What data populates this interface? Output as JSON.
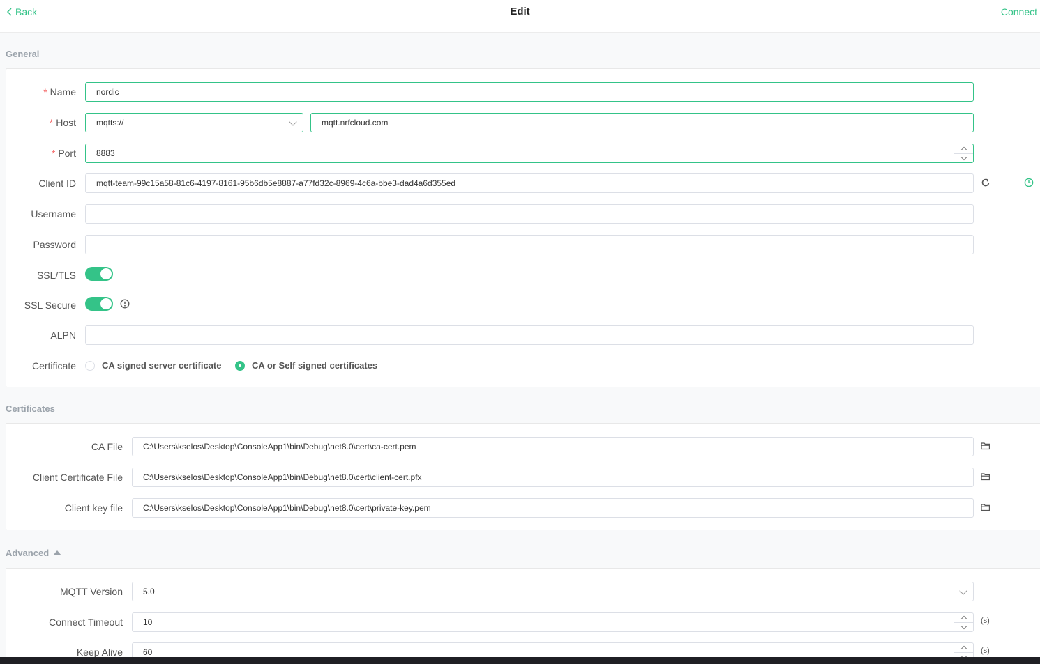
{
  "header": {
    "back_label": "Back",
    "title": "Edit",
    "connect_label": "Connect"
  },
  "general": {
    "section_title": "General",
    "name": {
      "label": "Name",
      "value": "nordic"
    },
    "host": {
      "label": "Host",
      "protocol": "mqtts://",
      "value": "mqtt.nrfcloud.com"
    },
    "port": {
      "label": "Port",
      "value": "8883"
    },
    "client_id": {
      "label": "Client ID",
      "value": "mqtt-team-99c15a58-81c6-4197-8161-95b6db5e8887-a77fd32c-8969-4c6a-bbe3-dad4a6d355ed"
    },
    "username": {
      "label": "Username",
      "value": ""
    },
    "password": {
      "label": "Password",
      "value": ""
    },
    "ssl_tls": {
      "label": "SSL/TLS",
      "enabled": true
    },
    "ssl_secure": {
      "label": "SSL Secure",
      "enabled": true
    },
    "alpn": {
      "label": "ALPN",
      "value": ""
    },
    "certificate": {
      "label": "Certificate",
      "options": [
        "CA signed server certificate",
        "CA or Self signed certificates"
      ],
      "selected": "CA or Self signed certificates"
    },
    "required_mark": "*"
  },
  "certificates": {
    "section_title": "Certificates",
    "ca_file": {
      "label": "CA File",
      "value": "C:\\Users\\kselos\\Desktop\\ConsoleApp1\\bin\\Debug\\net8.0\\cert\\ca-cert.pem"
    },
    "client_cert": {
      "label": "Client Certificate File",
      "value": "C:\\Users\\kselos\\Desktop\\ConsoleApp1\\bin\\Debug\\net8.0\\cert\\client-cert.pfx"
    },
    "client_key": {
      "label": "Client key file",
      "value": "C:\\Users\\kselos\\Desktop\\ConsoleApp1\\bin\\Debug\\net8.0\\cert\\private-key.pem"
    }
  },
  "advanced": {
    "section_title": "Advanced",
    "mqtt_version": {
      "label": "MQTT Version",
      "value": "5.0"
    },
    "connect_timeout": {
      "label": "Connect Timeout",
      "value": "10",
      "unit": "(s)"
    },
    "keep_alive": {
      "label": "Keep Alive",
      "value": "60",
      "unit": "(s)"
    }
  },
  "colors": {
    "accent": "#34c388",
    "required": "#f56c6c"
  }
}
